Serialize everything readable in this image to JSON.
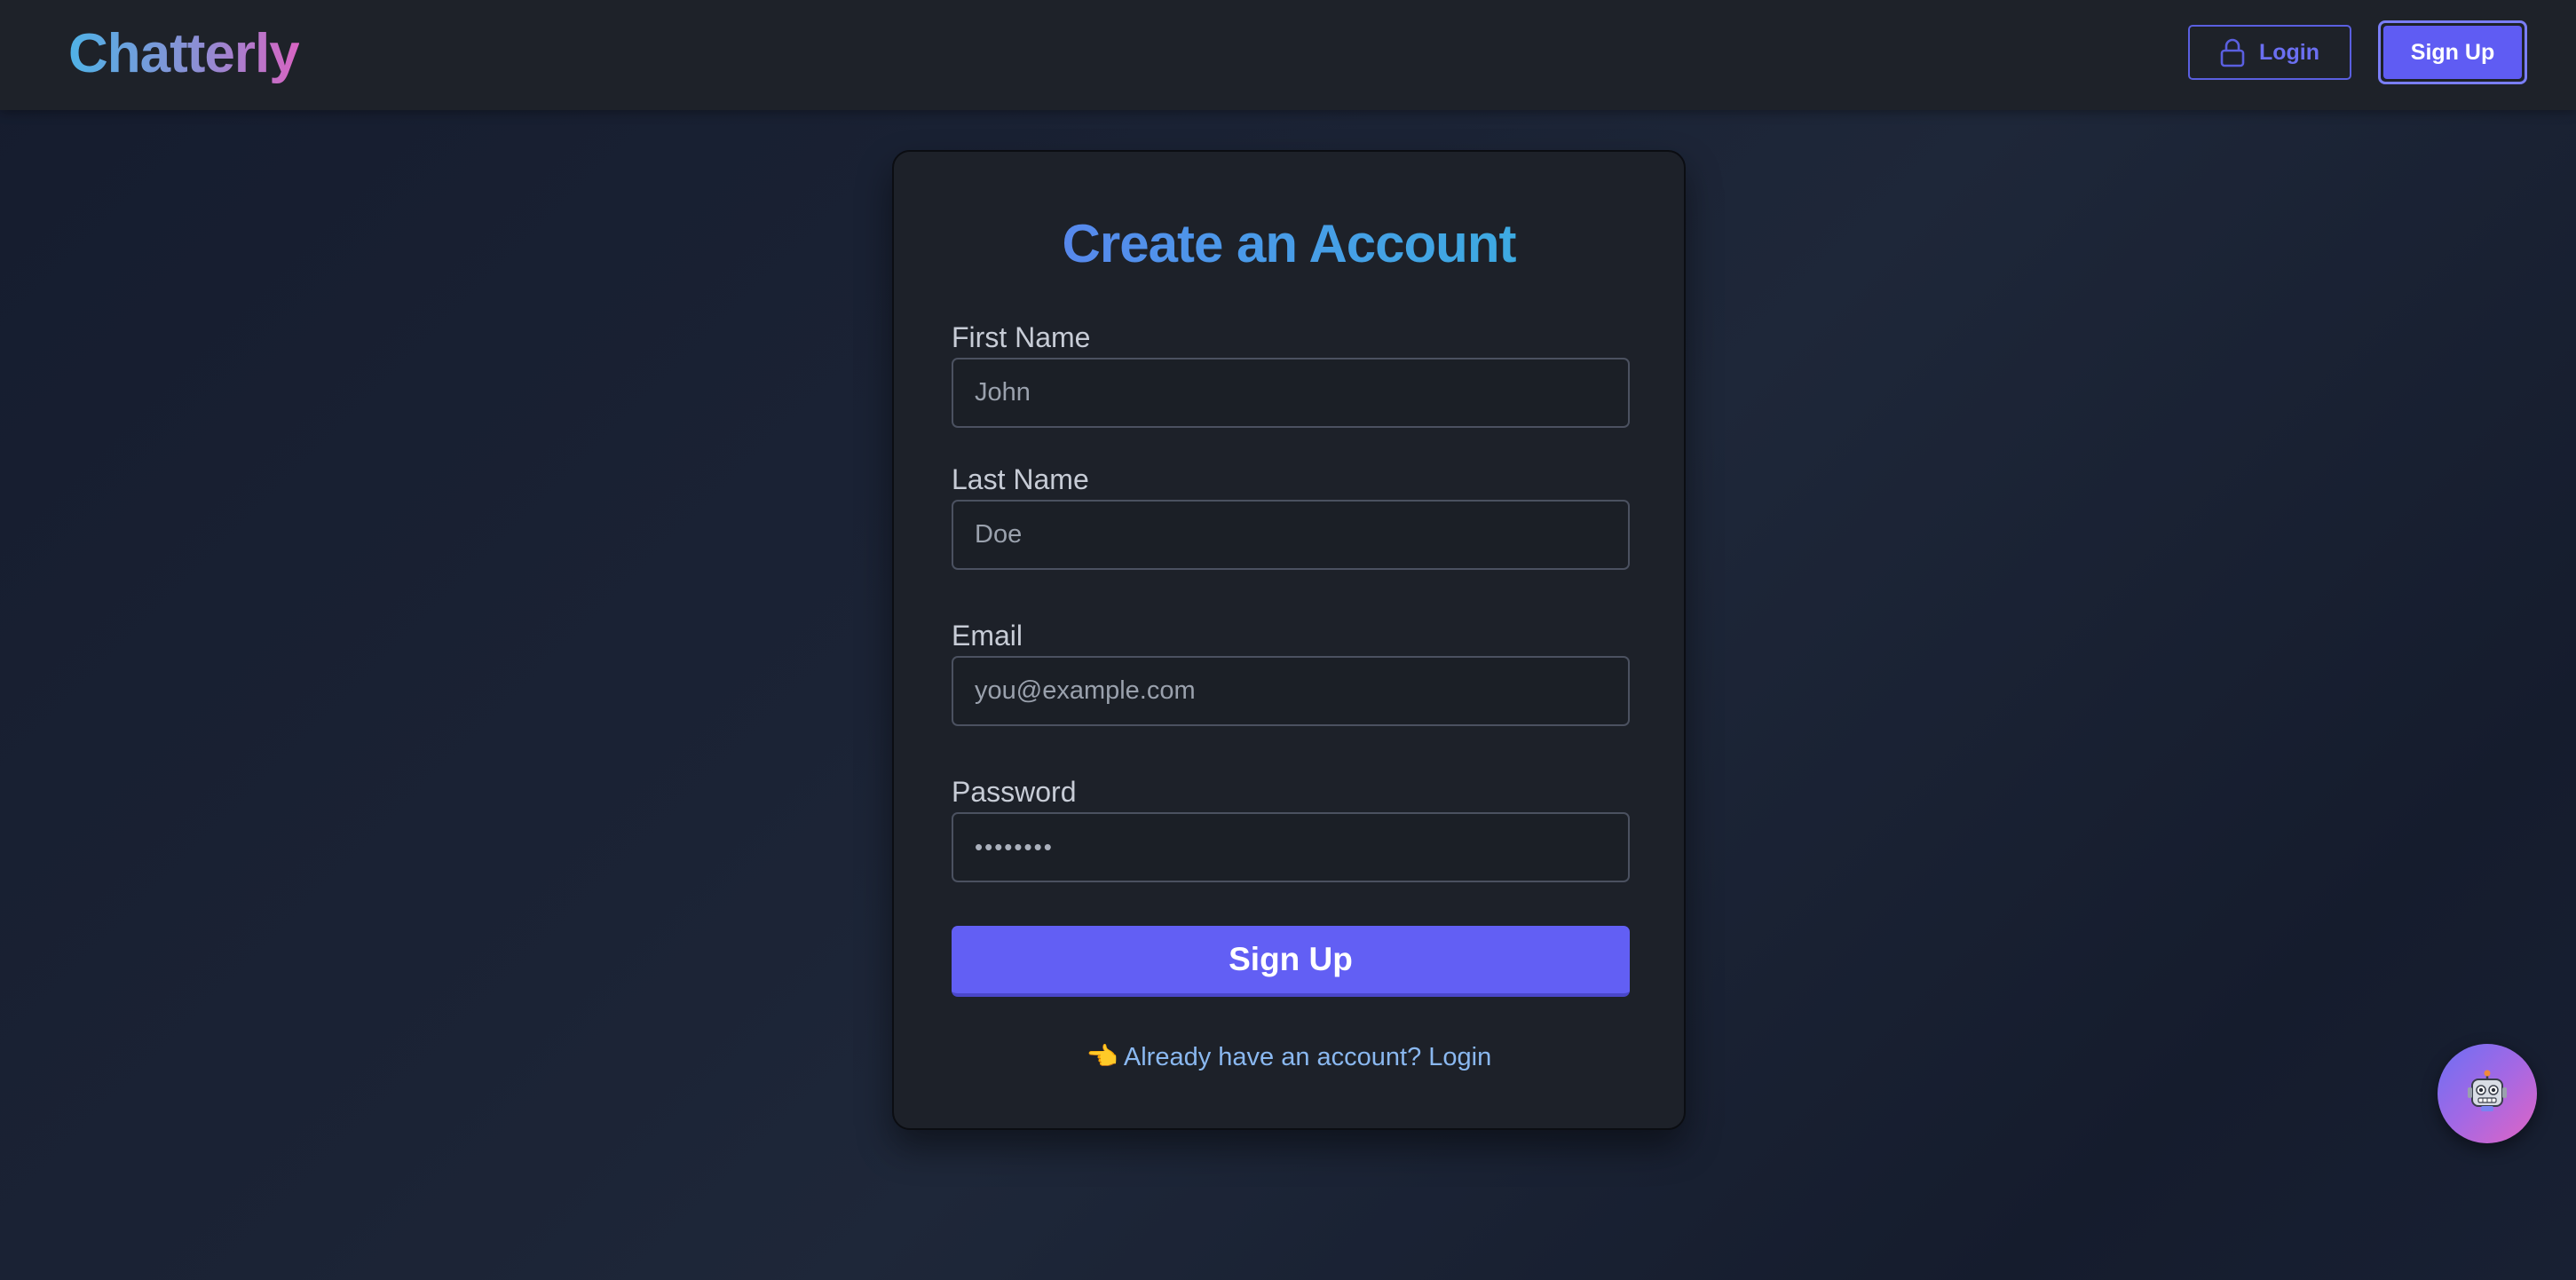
{
  "header": {
    "brand": "Chatterly",
    "login_label": "Login",
    "signup_label": "Sign Up",
    "login_icon": "lock-icon"
  },
  "form": {
    "title": "Create an Account",
    "first_name": {
      "label": "First Name",
      "placeholder": "John"
    },
    "last_name": {
      "label": "Last Name",
      "placeholder": "Doe"
    },
    "email": {
      "label": "Email",
      "placeholder": "you@example.com"
    },
    "password": {
      "label": "Password",
      "value_masked": "••••••••"
    },
    "submit_label": "Sign Up",
    "login_prompt": "Already have an account? Login",
    "login_prompt_icon": "👈"
  },
  "fab": {
    "icon": "robot-icon"
  },
  "colors": {
    "accent": "#625ff4",
    "background": "#1b2335",
    "card": "#1d2129",
    "link": "#8ab8f0"
  }
}
